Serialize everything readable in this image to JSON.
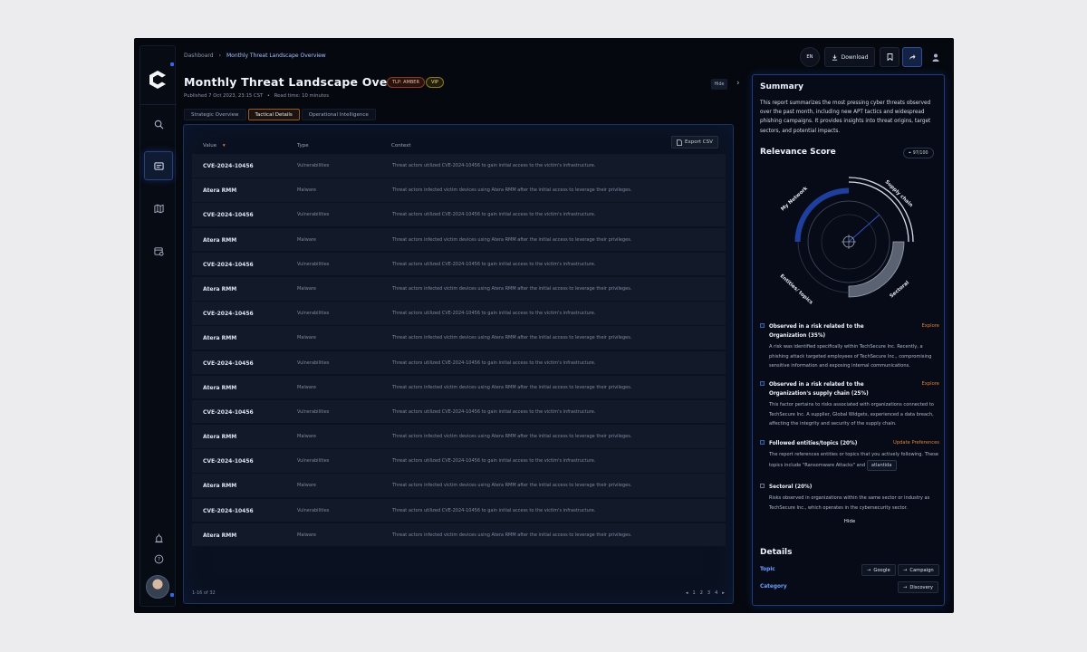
{
  "breadcrumb": {
    "root": "Dashboard",
    "current": "Monthly Threat Landscape Overview"
  },
  "header": {
    "title": "Monthly Threat Landscape Overview",
    "tlp_badge": "TLP: AMBER",
    "vip_badge": "VIP",
    "published": "Published 7 Oct 2023, 23:15 CST",
    "separator": "•",
    "read_time": "Read time: 10 minutes",
    "hide_label": "Hide"
  },
  "toolbar": {
    "lang": "EN",
    "download_label": "Download"
  },
  "tabs": [
    {
      "label": "Strategic Overview",
      "active": false
    },
    {
      "label": "Tactical Details",
      "active": true
    },
    {
      "label": "Operational Intelligence",
      "active": false
    }
  ],
  "table": {
    "columns": [
      "Value",
      "Type",
      "Context"
    ],
    "export_label": "Export CSV",
    "rows": [
      [
        "CVE-2024-10456",
        "Vulnerabilities",
        "Threat actors utilized CVE-2024-10456 to gain initial access to the victim's infrastructure."
      ],
      [
        "Atera RMM",
        "Malware",
        "Threat actors infected victim devices using Atera RMM after the initial access to leverage their privileges."
      ],
      [
        "CVE-2024-10456",
        "Vulnerabilities",
        "Threat actors utilized CVE-2024-10456 to gain initial access to the victim's infrastructure."
      ],
      [
        "Atera RMM",
        "Malware",
        "Threat actors infected victim devices using Atera RMM after the initial access to leverage their privileges."
      ],
      [
        "CVE-2024-10456",
        "Vulnerabilities",
        "Threat actors utilized CVE-2024-10456 to gain initial access to the victim's infrastructure."
      ],
      [
        "Atera RMM",
        "Malware",
        "Threat actors infected victim devices using Atera RMM after the initial access to leverage their privileges."
      ],
      [
        "CVE-2024-10456",
        "Vulnerabilities",
        "Threat actors utilized CVE-2024-10456 to gain initial access to the victim's infrastructure."
      ],
      [
        "Atera RMM",
        "Malware",
        "Threat actors infected victim devices using Atera RMM after the initial access to leverage their privileges."
      ],
      [
        "CVE-2024-10456",
        "Vulnerabilities",
        "Threat actors utilized CVE-2024-10456 to gain initial access to the victim's infrastructure."
      ],
      [
        "Atera RMM",
        "Malware",
        "Threat actors infected victim devices using Atera RMM after the initial access to leverage their privileges."
      ],
      [
        "CVE-2024-10456",
        "Vulnerabilities",
        "Threat actors utilized CVE-2024-10456 to gain initial access to the victim's infrastructure."
      ],
      [
        "Atera RMM",
        "Malware",
        "Threat actors infected victim devices using Atera RMM after the initial access to leverage their privileges."
      ],
      [
        "CVE-2024-10456",
        "Vulnerabilities",
        "Threat actors utilized CVE-2024-10456 to gain initial access to the victim's infrastructure."
      ],
      [
        "Atera RMM",
        "Malware",
        "Threat actors infected victim devices using Atera RMM after the initial access to leverage their privileges."
      ],
      [
        "CVE-2024-10456",
        "Vulnerabilities",
        "Threat actors utilized CVE-2024-10456 to gain initial access to the victim's infrastructure."
      ],
      [
        "Atera RMM",
        "Malware",
        "Threat actors infected victim devices using Atera RMM after the initial access to leverage their privileges."
      ]
    ],
    "range_label": "1-16 of 32",
    "pages": [
      "1",
      "2",
      "3",
      "4"
    ]
  },
  "summary": {
    "heading": "Summary",
    "text": "This report summarizes the most pressing cyber threats observed over the past month, including new APT tactics and widespread phishing campaigns. It provides insights into threat origins, target sectors, and potential impacts."
  },
  "relevance": {
    "heading": "Relevance Score",
    "score": "97/100",
    "labels": {
      "network": "My Network",
      "supply": "Supply chain",
      "entities": "Entities/ topics",
      "sectoral": "Sectoral"
    },
    "factors": [
      {
        "title": "Observed in a risk related to the Organization (35%)",
        "link": "Explore",
        "text": "A risk was identified specifically within TechSecure Inc. Recently, a phishing attack targeted employees of TechSecure Inc., compromising sensitive information and exposing internal communications."
      },
      {
        "title": "Observed in a risk related to the Organization's supply chain (25%)",
        "link": "Explore",
        "text": "This factor pertains to risks associated with organizations connected to TechSecure Inc. A supplier, Global Widgets, experienced a data breach, affecting the integrity and security of the supply chain."
      },
      {
        "title": "Followed entities/topics (20%)",
        "link": "Update Preferences",
        "text": "The report references entities or topics that you actively following. These topics include \"Ransomware Attacks\" and",
        "chip": "atlantida"
      },
      {
        "title": "Sectoral (20%)",
        "link": "",
        "text": "Risks observed in organizations within the same sector or industry as TechSecure Inc., which operates in the cybersecurity sector."
      }
    ],
    "hide_label": "Hide"
  },
  "details": {
    "heading": "Details",
    "topic_label": "Topic",
    "topic_chips": [
      "Google",
      "Campaign"
    ],
    "category_label": "Category",
    "category_chips": [
      "Discovery"
    ]
  },
  "colors": {
    "accent": "#3b63e8",
    "link": "#e2803a",
    "panel_border": "#1d3d7e"
  }
}
